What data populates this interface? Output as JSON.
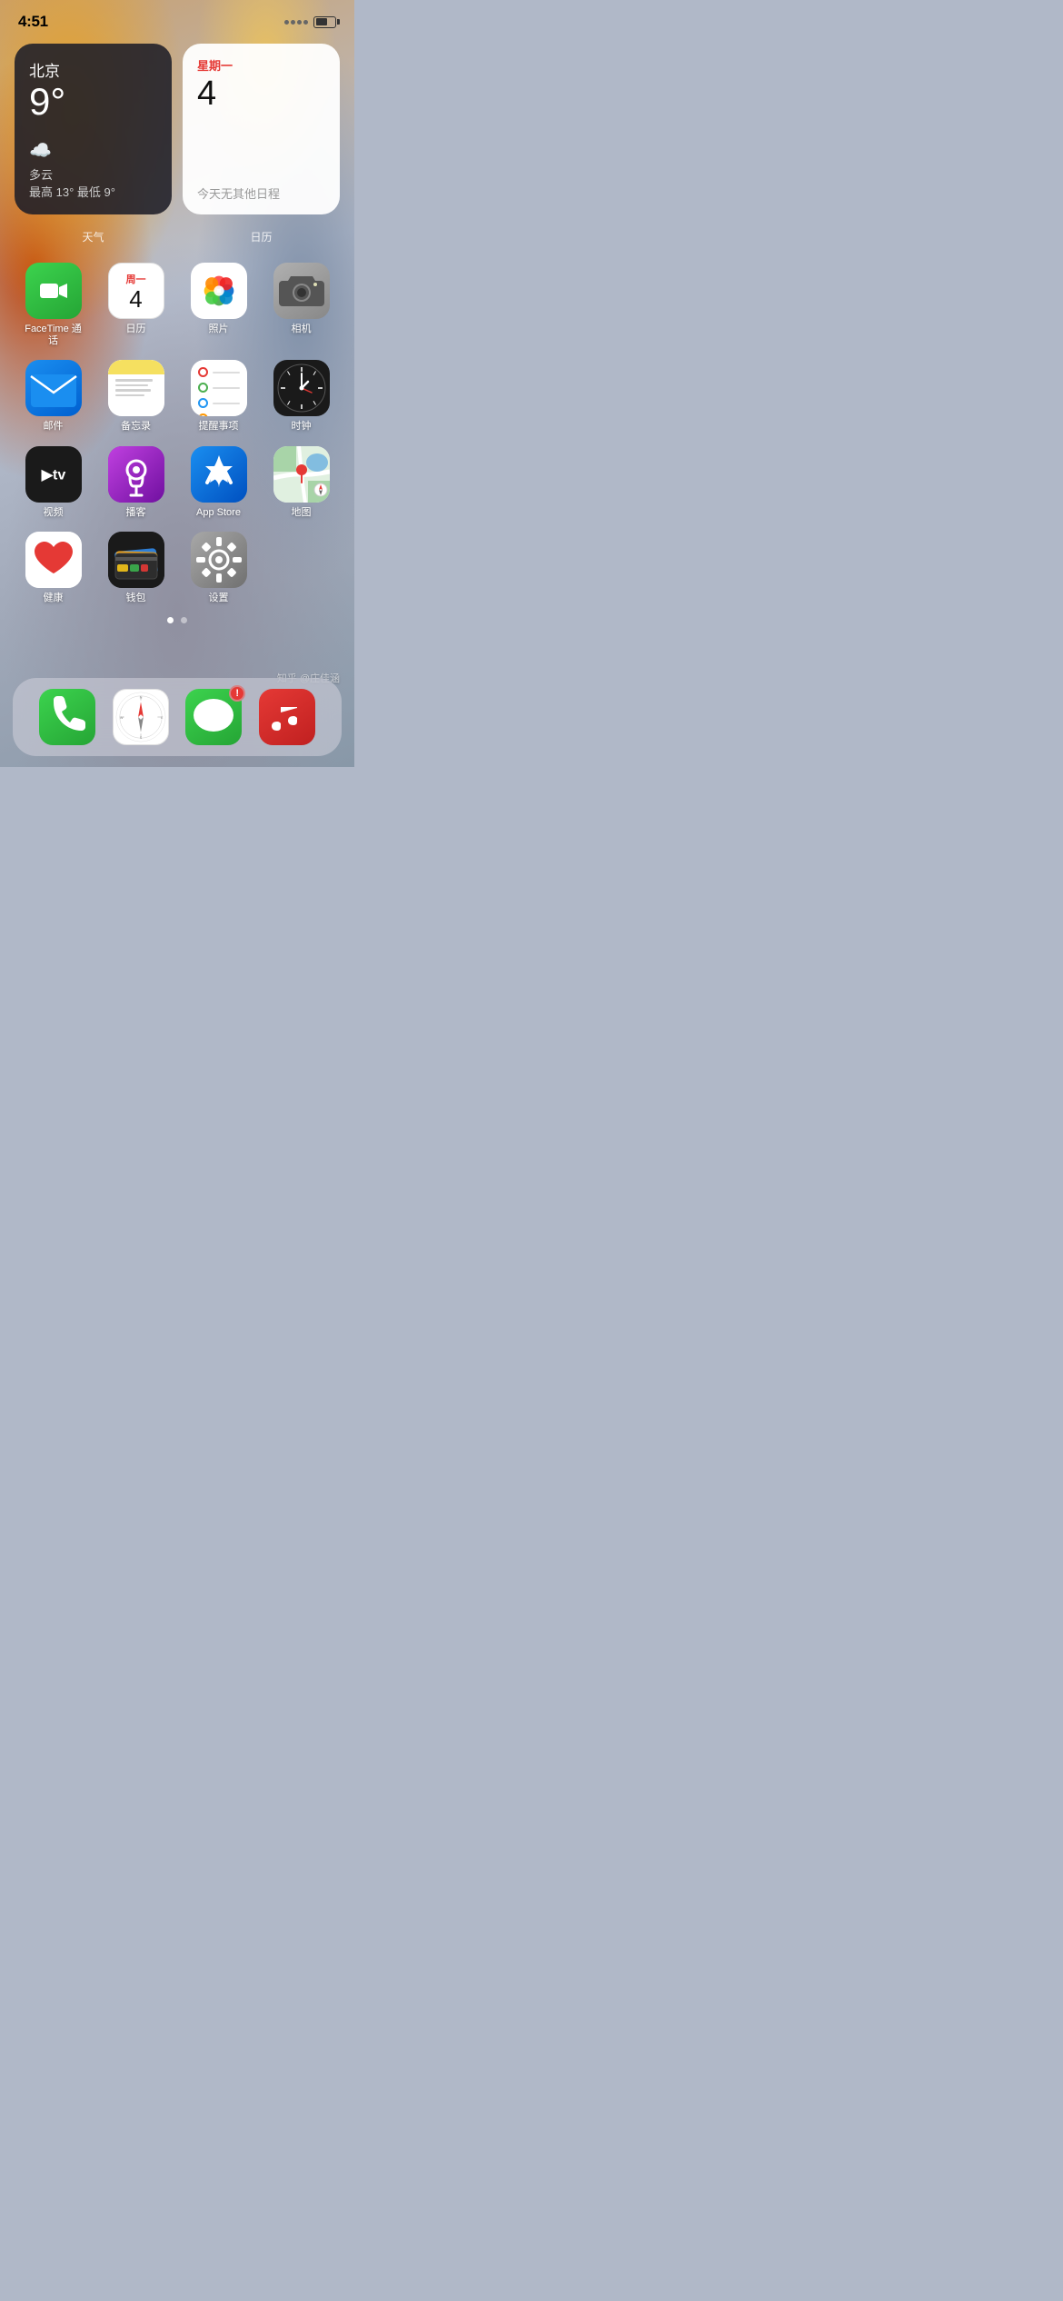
{
  "status": {
    "time": "4:51",
    "battery_level": 60
  },
  "widgets": {
    "weather": {
      "city": "北京",
      "temp": "9°",
      "condition": "多云",
      "range": "最高 13° 最低 9°",
      "label": "天气"
    },
    "calendar": {
      "day_label": "星期一",
      "date_number": "4",
      "no_events": "今天无其他日程",
      "label": "日历"
    }
  },
  "apps_row1": [
    {
      "id": "facetime",
      "label": "FaceTime 通话"
    },
    {
      "id": "calendar",
      "label": "日历"
    },
    {
      "id": "photos",
      "label": "照片"
    },
    {
      "id": "camera",
      "label": "相机"
    }
  ],
  "apps_row2": [
    {
      "id": "mail",
      "label": "邮件"
    },
    {
      "id": "notes",
      "label": "备忘录"
    },
    {
      "id": "reminders",
      "label": "提醒事项"
    },
    {
      "id": "clock",
      "label": "时钟"
    }
  ],
  "apps_row3": [
    {
      "id": "tv",
      "label": "视频"
    },
    {
      "id": "podcasts",
      "label": "播客"
    },
    {
      "id": "appstore",
      "label": "App Store"
    },
    {
      "id": "maps",
      "label": "地图"
    }
  ],
  "apps_row4": [
    {
      "id": "health",
      "label": "健康"
    },
    {
      "id": "wallet",
      "label": "钱包"
    },
    {
      "id": "settings",
      "label": "设置"
    }
  ],
  "dock": {
    "apps": [
      {
        "id": "phone",
        "label": "电话",
        "badge": null
      },
      {
        "id": "safari",
        "label": "Safari",
        "badge": null
      },
      {
        "id": "messages",
        "label": "信息",
        "badge": "!"
      },
      {
        "id": "music",
        "label": "音乐",
        "badge": null
      }
    ]
  },
  "page_dots": [
    {
      "active": true
    },
    {
      "active": false
    }
  ],
  "watermark": "知乎 @庄佳涵",
  "calendar_day_num": "4",
  "calendar_day_text": "周一"
}
